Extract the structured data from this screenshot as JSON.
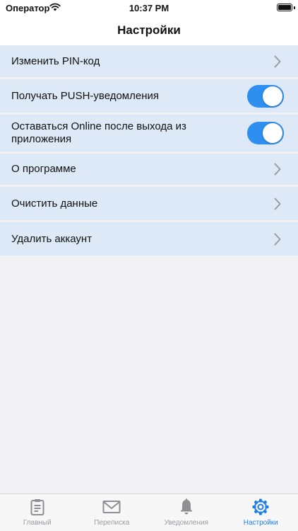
{
  "status_bar": {
    "carrier": "Оператор",
    "time": "10:37 PM"
  },
  "nav": {
    "title": "Настройки"
  },
  "settings": [
    {
      "label": "Изменить PIN-код",
      "control": "chevron-right-icon"
    },
    {
      "label": "Получать PUSH-уведомления",
      "control": "toggle",
      "on": true
    },
    {
      "label": "Оставаться Online после выхода из приложения",
      "control": "toggle",
      "on": true
    },
    {
      "label": "О программе",
      "control": "chevron-right-icon"
    },
    {
      "label": "Очистить данные",
      "control": "chevron-right-icon"
    },
    {
      "label": "Удалить аккаунт",
      "control": "chevron-right-icon"
    }
  ],
  "tabs": [
    {
      "label": "Главный",
      "icon": "clipboard-icon",
      "active": false
    },
    {
      "label": "Переписка",
      "icon": "envelope-icon",
      "active": false
    },
    {
      "label": "Уведомления",
      "icon": "bell-icon",
      "active": false
    },
    {
      "label": "Настройки",
      "icon": "gear-icon",
      "active": true
    }
  ],
  "colors": {
    "accent": "#2f8ff0",
    "active_tab": "#1f7fe6",
    "row_bg": "#dde9f7",
    "page_bg": "#f2f2f4"
  }
}
